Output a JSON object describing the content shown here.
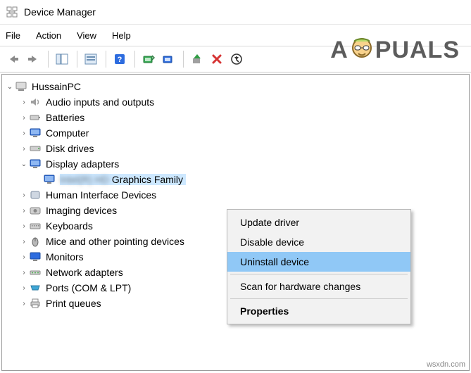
{
  "title": "Device Manager",
  "menu": {
    "file": "File",
    "action": "Action",
    "view": "View",
    "help": "Help"
  },
  "tree": {
    "root": "HussainPC",
    "items": [
      {
        "label": "Audio inputs and outputs"
      },
      {
        "label": "Batteries"
      },
      {
        "label": "Computer"
      },
      {
        "label": "Disk drives"
      },
      {
        "label": "Display adapters",
        "expanded": true
      },
      {
        "label": "Human Interface Devices"
      },
      {
        "label": "Imaging devices"
      },
      {
        "label": "Keyboards"
      },
      {
        "label": "Mice and other pointing devices"
      },
      {
        "label": "Monitors"
      },
      {
        "label": "Network adapters"
      },
      {
        "label": "Ports (COM & LPT)"
      },
      {
        "label": "Print queues"
      }
    ],
    "display_child_hidden": "Intel(R) HD",
    "display_child_visible": "Graphics Family"
  },
  "context_menu": {
    "update": "Update driver",
    "disable": "Disable device",
    "uninstall": "Uninstall device",
    "scan": "Scan for hardware changes",
    "properties": "Properties"
  },
  "watermark": {
    "pre": "A",
    "post": "PUALS"
  },
  "site_mark": "wsxdn.com"
}
